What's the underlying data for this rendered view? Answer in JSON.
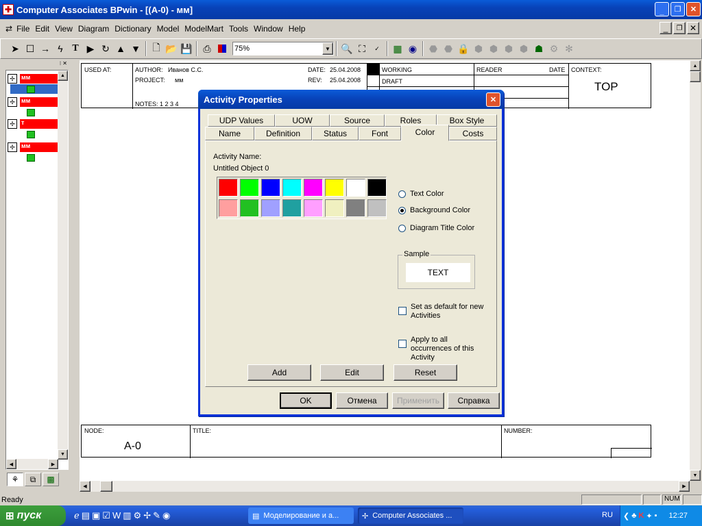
{
  "window": {
    "title": "Computer Associates BPwin - [(A-0)  - мм]"
  },
  "menu": {
    "items": [
      "File",
      "Edit",
      "View",
      "Diagram",
      "Dictionary",
      "Model",
      "ModelMart",
      "Tools",
      "Window",
      "Help"
    ]
  },
  "toolbar": {
    "zoom": "75%"
  },
  "tree": {
    "items": [
      "мм",
      "мм",
      "т",
      "мм"
    ]
  },
  "frame": {
    "used_at": "USED AT:",
    "author_label": "AUTHOR:",
    "author": "Иванов С.С.",
    "project_label": "PROJECT:",
    "project": "мм",
    "date_label": "DATE:",
    "date": "25.04.2008",
    "rev_label": "REV:",
    "rev": "25.04.2008",
    "notes": "NOTES: 1 2 3 4",
    "working": "WORKING",
    "draft": "DRAFT",
    "reader": "READER",
    "reader_date": "DATE",
    "context": "CONTEXT:",
    "context_value": "TOP",
    "node_label": "NODE:",
    "node": "A-0",
    "title_label": "TITLE:",
    "number_label": "NUMBER:"
  },
  "dialog": {
    "title": "Activity Properties",
    "tabs_row1": [
      "UDP Values",
      "UOW",
      "Source",
      "Roles",
      "Box Style"
    ],
    "tabs_row2": [
      "Name",
      "Definition",
      "Status",
      "Font",
      "Color",
      "Costs"
    ],
    "active_tab": "Color",
    "activity_name_label": "Activity Name:",
    "activity_name": "Untitled Object 0",
    "colors_row1": [
      "#ff0000",
      "#00ff00",
      "#0000ff",
      "#00ffff",
      "#ff00ff",
      "#ffff00",
      "#ffffff",
      "#000000"
    ],
    "colors_row2": [
      "#ff9f9f",
      "#22c022",
      "#a0a0ff",
      "#20a0a0",
      "#ff9fff",
      "#f0f0c0",
      "#808080",
      "#c0c0c0"
    ],
    "radio_text": "Text Color",
    "radio_background": "Background Color",
    "radio_title": "Diagram Title Color",
    "selected_radio": "Background Color",
    "sample_label": "Sample",
    "sample_text": "TEXT",
    "chk_default": "Set as default for new Activities",
    "chk_apply": "Apply to all occurrences of this Activity",
    "btn_add": "Add",
    "btn_edit": "Edit",
    "btn_reset": "Reset",
    "btn_ok": "OK",
    "btn_cancel": "Отмена",
    "btn_apply": "Применить",
    "btn_help": "Справка"
  },
  "status": {
    "text": "Ready",
    "num": "NUM"
  },
  "taskbar": {
    "start": "пуск",
    "tasks": [
      "Моделирование и а...",
      "Computer Associates ..."
    ],
    "lang": "RU",
    "clock": "12:27"
  }
}
